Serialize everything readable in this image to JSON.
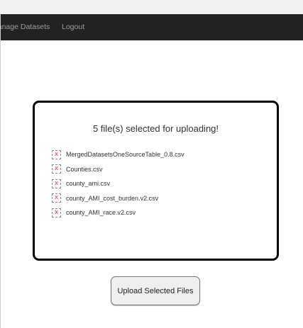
{
  "navbar": {
    "links": [
      {
        "label": "Manage Datasets"
      },
      {
        "label": "Logout"
      }
    ]
  },
  "upload_panel": {
    "title": "5 file(s) selected for uploading!",
    "files": [
      {
        "name": "MergedDatasetsOneSourceTable_0.8.csv",
        "icon": "broken-file-icon"
      },
      {
        "name": "Counties.csv",
        "icon": "broken-file-icon"
      },
      {
        "name": "county_ami.csv",
        "icon": "broken-file-icon"
      },
      {
        "name": "county_AMI_cost_burden.v2.csv",
        "icon": "broken-file-icon"
      },
      {
        "name": "county_AMI_race.v2.csv",
        "icon": "broken-file-icon"
      }
    ],
    "icon_glyph": "x"
  },
  "upload_button": {
    "label": "Upload Selected Files"
  },
  "colors": {
    "navbar_bg": "#222222",
    "nav_link": "#9d9d9d",
    "icon_mark": "#e23b2e",
    "panel_border": "#000000"
  }
}
